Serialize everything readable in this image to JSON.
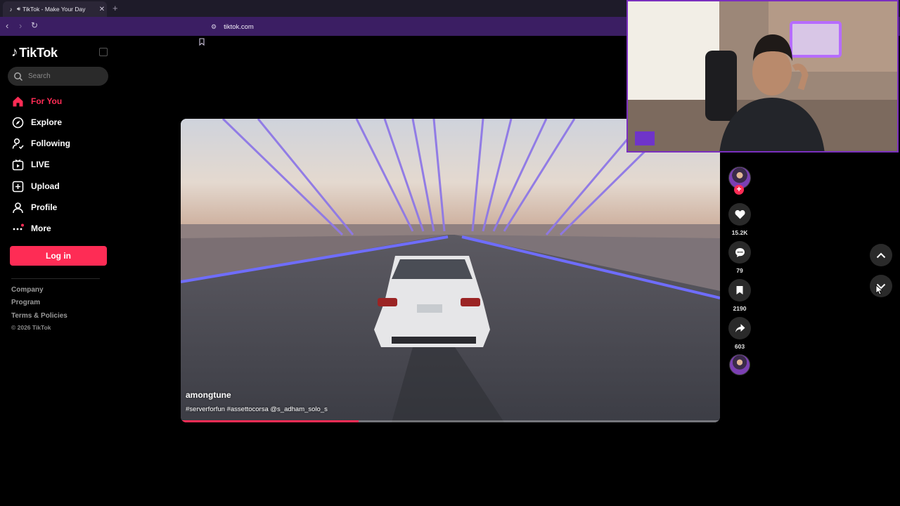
{
  "browser": {
    "tab_title": "TikTok - Make Your Day",
    "url": "tiktok.com"
  },
  "sidebar": {
    "logo_text": "TikTok",
    "search_placeholder": "Search",
    "menu": [
      {
        "label": "For You",
        "icon": "home-icon",
        "active": true
      },
      {
        "label": "Explore",
        "icon": "compass-icon"
      },
      {
        "label": "Following",
        "icon": "following-icon"
      },
      {
        "label": "LIVE",
        "icon": "live-icon"
      },
      {
        "label": "Upload",
        "icon": "upload-icon"
      },
      {
        "label": "Profile",
        "icon": "profile-icon"
      },
      {
        "label": "More",
        "icon": "more-icon"
      }
    ],
    "login_label": "Log in",
    "footer": [
      "Company",
      "Program",
      "Terms & Policies"
    ],
    "copyright": "© 2026 TikTok"
  },
  "video": {
    "username": "amongtune",
    "caption": "#serverforfun #assettocorsa @s_adham_solo_s",
    "progress": 0.33
  },
  "actions": {
    "likes": "15.2K",
    "comments": "79",
    "saves": "2190",
    "shares": "603"
  },
  "colors": {
    "accent": "#fe2c55",
    "toolbar": "#3b1e63",
    "webcam_border": "#7b2fbf"
  }
}
